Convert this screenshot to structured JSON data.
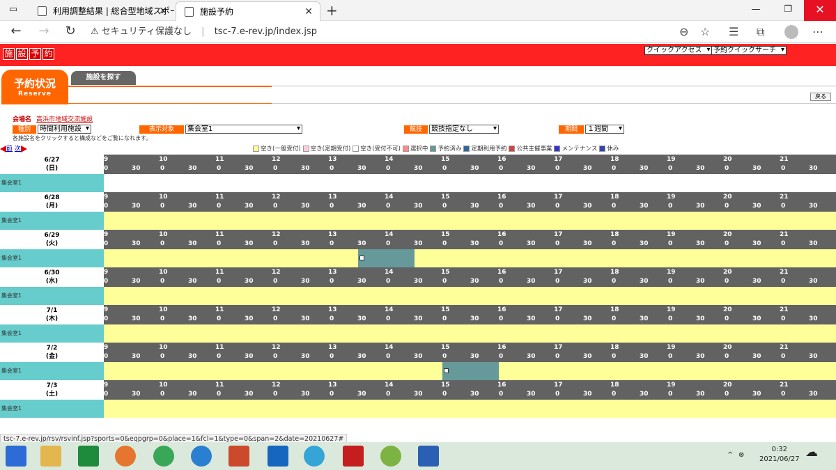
{
  "browser": {
    "tabs": [
      {
        "label": "利用調整結果 | 総合型地域スポー"
      },
      {
        "label": "施設予約"
      }
    ],
    "security": "セキュリティ保護なし",
    "url": "tsc-7.e-rev.jp/index.jsp"
  },
  "site": {
    "logo": [
      "施",
      "設",
      "予",
      "約"
    ],
    "quick_access": "クイックアクセス",
    "quick_search": "予約クイックサーチ",
    "tab_active": "予約状況",
    "tab_active_sub": "Reserve",
    "tab_other": "施設を探す",
    "back": "戻る"
  },
  "filters": {
    "venue_label": "会場名",
    "venue_value": "高浜市地域交流施設",
    "f1_label": "種別",
    "f1_value": "時間利用施設",
    "f2_label": "表示対象",
    "f2_value": "集会室1",
    "f3_label": "競技",
    "f3_value": "競技指定なし",
    "f4_label": "期間",
    "f4_value": "１週間"
  },
  "hint": "各施設名をクリックすると構成などをご覧になれます。",
  "nav": {
    "prev": "前",
    "next": "次"
  },
  "legend": [
    {
      "label": "空き(一般受付)",
      "color": "#ffff99"
    },
    {
      "label": "空き(定期受付)",
      "color": "#ffccdd"
    },
    {
      "label": "空き(受付不可)",
      "color": "#ffffff"
    },
    {
      "label": "選択中",
      "color": "#ff8888"
    },
    {
      "label": "予約済み",
      "color": "#669999"
    },
    {
      "label": "定期利用予約",
      "color": "#336699"
    },
    {
      "label": "公共主催事業",
      "color": "#cc4444"
    },
    {
      "label": "メンテナンス",
      "color": "#3333cc"
    },
    {
      "label": "休み",
      "color": "#3344aa"
    }
  ],
  "hours": [
    "9",
    "10",
    "11",
    "12",
    "13",
    "14",
    "15",
    "16",
    "17",
    "18",
    "19",
    "20",
    "21"
  ],
  "half": [
    "0",
    "30"
  ],
  "days": [
    {
      "date": "6/27",
      "dow": "(日)",
      "facility": "集会室1",
      "bg": "white",
      "booked": []
    },
    {
      "date": "6/28",
      "dow": "(月)",
      "facility": "集会室1",
      "bg": "yellow",
      "booked": []
    },
    {
      "date": "6/29",
      "dow": "(火)",
      "facility": "集会室1",
      "bg": "yellow",
      "booked": [
        {
          "start": 13.5,
          "end": 14.5
        }
      ]
    },
    {
      "date": "6/30",
      "dow": "(水)",
      "facility": "集会室1",
      "bg": "yellow",
      "booked": []
    },
    {
      "date": "7/1",
      "dow": "(木)",
      "facility": "集会室1",
      "bg": "yellow",
      "booked": []
    },
    {
      "date": "7/2",
      "dow": "(金)",
      "facility": "集会室1",
      "bg": "yellow",
      "booked": [
        {
          "start": 15,
          "end": 16
        }
      ]
    },
    {
      "date": "7/3",
      "dow": "(土)",
      "facility": "集会室1",
      "bg": "yellow",
      "booked": []
    }
  ],
  "status_url": "tsc-7.e-rev.jp/rsv/rsvinf.jsp?sports=0&eqpgrp=0&place=1&fcl=1&type=0&span=2&date=20210627#",
  "taskbar": {
    "time": "0:32",
    "date": "2021/06/27"
  }
}
